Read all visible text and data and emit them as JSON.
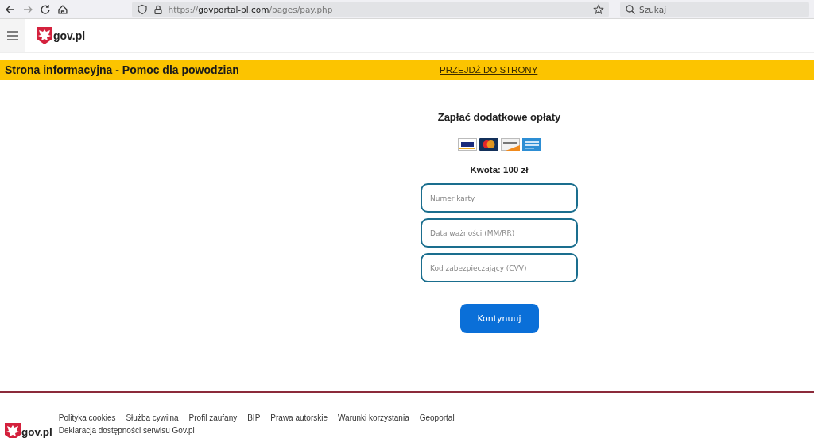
{
  "browser": {
    "url": "https://**govportal-pl.com**/pages/pay.php",
    "search": {
      "placeholder": "Szukaj"
    }
  },
  "header": {
    "logo_text": "gov.pl"
  },
  "banner": {
    "title": "Strona informacyjna - Pomoc dla powodzian",
    "link": "PRZEJDŹ DO STRONY"
  },
  "payment": {
    "title": "Zapłać dodatkowe opłaty",
    "cards": [
      {
        "kind": "visa"
      },
      {
        "kind": "mastercard"
      },
      {
        "kind": "discover"
      },
      {
        "kind": "amex"
      }
    ],
    "amount": "Kwota: 100 zł",
    "fields": [
      {
        "placeholder": "Numer karty"
      },
      {
        "placeholder": "Data ważności (MM/RR)"
      },
      {
        "placeholder": "Kod zabezpieczający (CVV)"
      }
    ],
    "submit": "Kontynuuj"
  },
  "footer": {
    "logo_text": "gov.pl",
    "links": [
      "Polityka cookies",
      "Służba cywilna",
      "Profil zaufany",
      "BIP",
      "Prawa autorskie",
      "Warunki korzystania",
      "Geoportal",
      "Deklaracja dostępności serwisu Gov.pl"
    ]
  }
}
